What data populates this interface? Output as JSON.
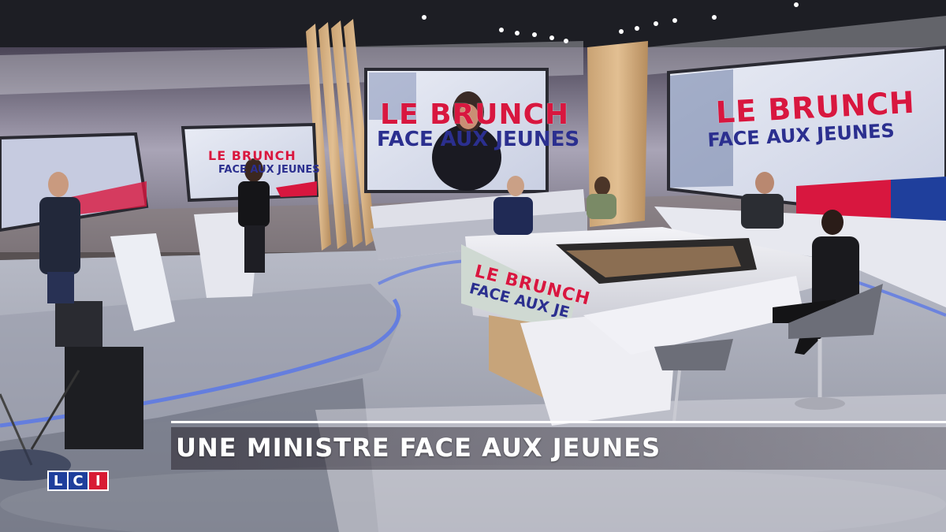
{
  "broadcast": {
    "channel_logo": {
      "l": "L",
      "c": "C",
      "i": "I"
    },
    "headline": "UNE MINISTRE FACE AUX JEUNES"
  },
  "screens": {
    "center": {
      "title": "LE BRUNCH",
      "subtitle": "FACE AUX JEUNES"
    },
    "right": {
      "title": "LE BRUNCH",
      "subtitle": "FACE AUX JEUNES"
    },
    "left_small": {
      "title": "LE BRUNCH",
      "subtitle": "FACE AUX JEUNES"
    },
    "desk_front": {
      "title": "LE BRUNCH",
      "subtitle": "FACE AUX JE"
    }
  },
  "colors": {
    "brand_red": "#d8173f",
    "brand_blue": "#2b2f8f",
    "logo_blue": "#1f3f9c",
    "logo_red": "#d81b34"
  }
}
